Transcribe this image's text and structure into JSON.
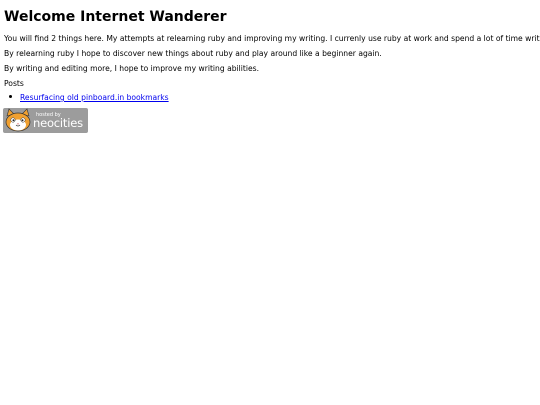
{
  "page": {
    "title": "Welcome Internet Wanderer",
    "paragraphs": [
      "You will find 2 things here. My attempts at relearning ruby and improving my writing. I currenly use ruby at work and spend a lot of time writing.",
      "By relearning ruby I hope to discover new things about ruby and play around like a beginner again.",
      "By writing and editing more, I hope to improve my writing abilities."
    ],
    "posts_label": "Posts",
    "posts": [
      {
        "title": "Resurfacing old pinboard.in bookmarks"
      }
    ]
  },
  "badge": {
    "top_text": "hosted by",
    "main_text": "neocities",
    "icon": "neocities-cat-icon"
  },
  "colors": {
    "link": "#0000ee",
    "badge_bg": "#9c9c9c",
    "cat_orange": "#f0a030"
  }
}
